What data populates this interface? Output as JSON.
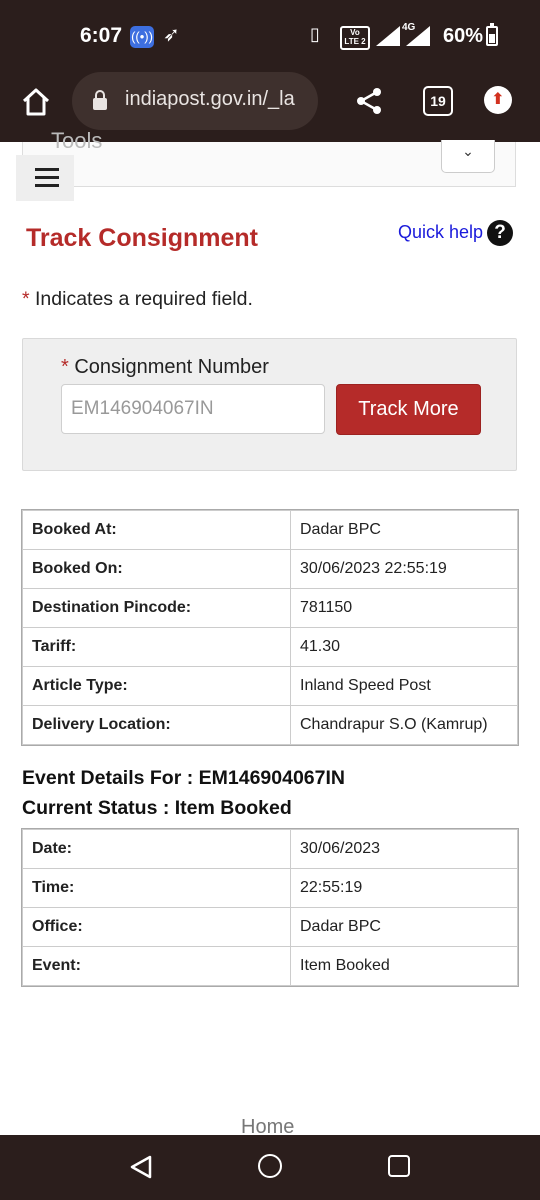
{
  "status_bar": {
    "time": "6:07",
    "volte": "Vo LTE 2",
    "network": "4G",
    "battery": "60%"
  },
  "browser": {
    "url": "indiapost.gov.in/_la",
    "tab_count": "19"
  },
  "nav": {
    "tools_label": "Tools"
  },
  "page": {
    "title": "Track Consignment",
    "quick_help": "Quick help",
    "help_symbol": "?",
    "required_star": "*",
    "required_note": " Indicates a required field.",
    "consignment_label": "Consignment Number",
    "consignment_value": "EM146904067IN",
    "track_button": "Track More"
  },
  "booking_details": [
    {
      "label": "Booked At:",
      "value": "Dadar BPC"
    },
    {
      "label": "Booked On:",
      "value": "30/06/2023 22:55:19"
    },
    {
      "label": "Destination Pincode:",
      "value": "781150"
    },
    {
      "label": "Tariff:",
      "value": "41.30"
    },
    {
      "label": "Article Type:",
      "value": "Inland Speed Post"
    },
    {
      "label": "Delivery Location:",
      "value": "Chandrapur S.O (Kamrup)"
    }
  ],
  "event": {
    "heading": "Event Details For : EM146904067IN",
    "status": "Current Status : Item Booked"
  },
  "event_details": [
    {
      "label": "Date:",
      "value": "30/06/2023"
    },
    {
      "label": "Time:",
      "value": "22:55:19"
    },
    {
      "label": "Office:",
      "value": "Dadar BPC"
    },
    {
      "label": "Event:",
      "value": "Item Booked"
    }
  ],
  "footer": {
    "home_link": "Home"
  },
  "icons": {
    "accent_color": "#b52b29",
    "chrome_color": "#2b1e1c"
  }
}
